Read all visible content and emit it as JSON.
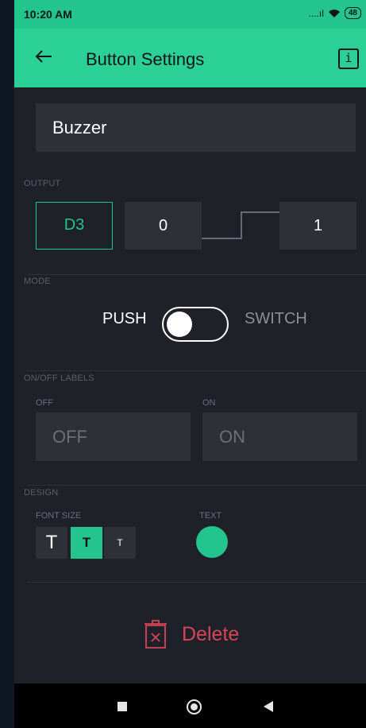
{
  "status_bar": {
    "time": "10:20 AM",
    "signal": "....ıl",
    "wifi_icon": "wifi-icon",
    "battery": "48"
  },
  "app_bar": {
    "title": "Button Settings",
    "back_icon": "back-arrow-icon",
    "info_label": "i"
  },
  "widget_name": "Buzzer",
  "output": {
    "section_label": "OUTPUT",
    "pin": "D3",
    "low_value": "0",
    "high_value": "1"
  },
  "mode": {
    "section_label": "MODE",
    "left_label": "PUSH",
    "right_label": "SWITCH",
    "toggle_state": "push"
  },
  "labels": {
    "section_label": "ON/OFF LABELS",
    "off_caption": "OFF",
    "on_caption": "ON",
    "off_placeholder": "OFF",
    "on_placeholder": "ON"
  },
  "design": {
    "section_label": "DESIGN",
    "font_size_caption": "FONT SIZE",
    "text_caption": "TEXT",
    "font_sizes": [
      "T",
      "T",
      "T"
    ],
    "selected_font_size": 1,
    "text_color": "#23c48e"
  },
  "delete_label": "Delete",
  "colors": {
    "accent": "#23c48e",
    "danger": "#d84559",
    "background": "#1e2128"
  }
}
